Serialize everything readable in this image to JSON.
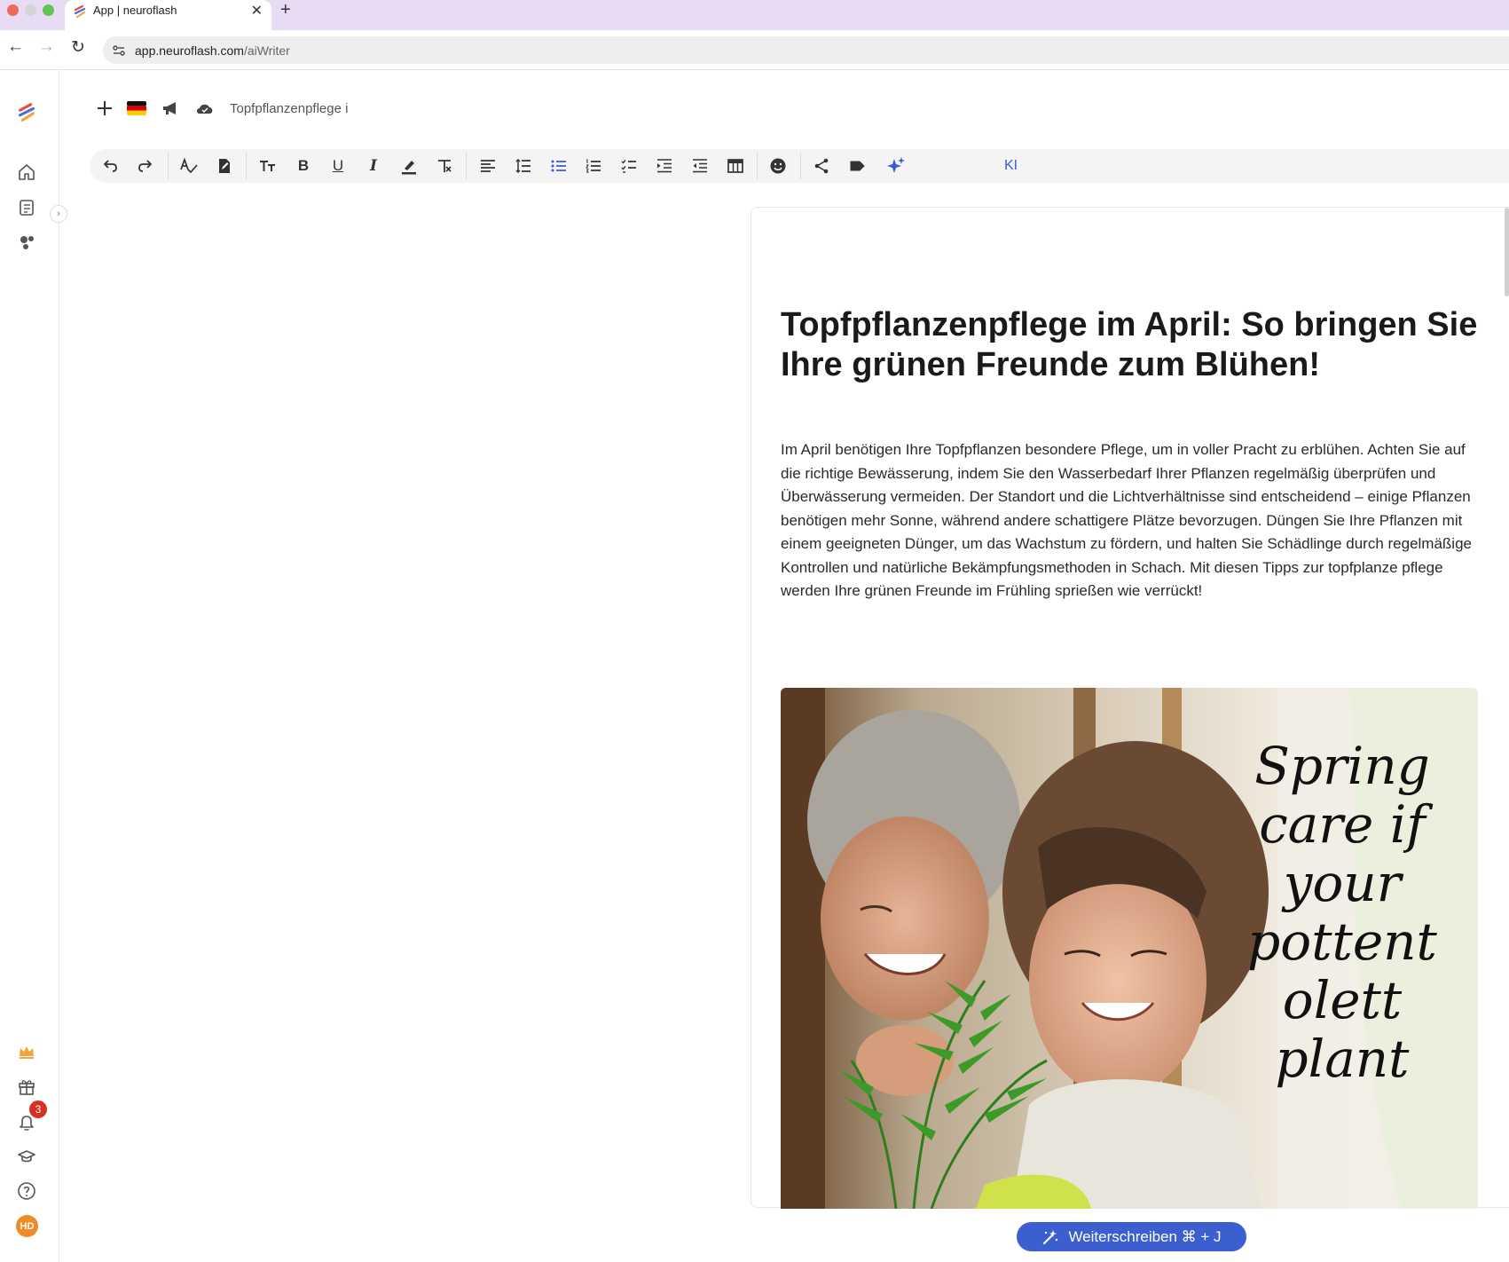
{
  "browser": {
    "tab_title": "App | neuroflash",
    "url_host": "app.neuroflash.com",
    "url_path": "/aiWriter",
    "new_tab_label": "+",
    "close_tab_label": "✕"
  },
  "sidebar": {
    "notification_count": "3",
    "avatar_initials": "HD",
    "collapse_label": "›"
  },
  "header": {
    "document_name": "Topfpflanzenpflege i"
  },
  "toolbar": {
    "ki_label": "KI",
    "bold_label": "B",
    "underline_label": "U",
    "italic_label": "I"
  },
  "document": {
    "title": "Topfpflanzenpflege im April: So bringen Sie Ihre grünen Freunde zum Blühen!",
    "body": "Im April benötigen Ihre Topfpflanzen besondere Pflege, um in voller Pracht zu erblühen. Achten Sie auf die richtige Bewässerung, indem Sie den Wasserbedarf Ihrer Pflanzen regelmäßig überprüfen und Überwässerung vermeiden. Der Standort und die Lichtverhältnisse sind entscheidend – einige Pflanzen benötigen mehr Sonne, während andere schattigere Plätze bevorzugen. Düngen Sie Ihre Pflanzen mit einem geeigneten Dünger, um das Wachstum zu fördern, und halten Sie Schädlinge durch regelmäßige Kontrollen und natürliche Bekämpfungsmethoden in Schach. Mit diesen Tipps zur topfplanze pflege werden Ihre grünen Freunde im Frühling sprießen wie verrückt!",
    "image_text": [
      "Spring",
      "care if",
      "your",
      "pottent",
      "olett",
      "plant"
    ]
  },
  "actions": {
    "continue_label": "Weiterschreiben ⌘ + J"
  },
  "colors": {
    "accent": "#3c5fd0",
    "tabbar": "#e8dcf5",
    "badge": "#d93025",
    "avatar": "#f08a24"
  }
}
